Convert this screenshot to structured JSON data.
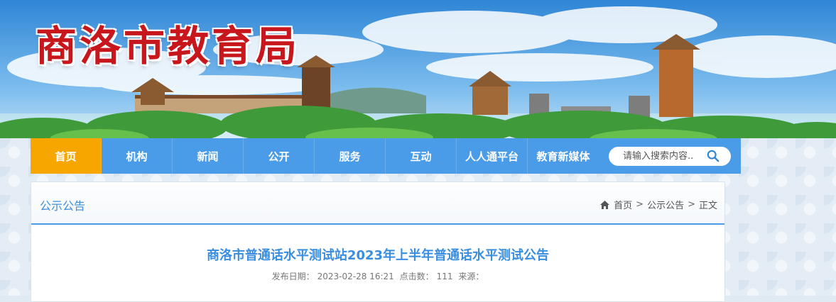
{
  "site": {
    "title": "商洛市教育局"
  },
  "nav": {
    "items": [
      {
        "label": "首页",
        "active": true
      },
      {
        "label": "机构"
      },
      {
        "label": "新闻"
      },
      {
        "label": "公开"
      },
      {
        "label": "服务"
      },
      {
        "label": "互动"
      },
      {
        "label": "人人通平台"
      },
      {
        "label": "教育新媒体"
      }
    ]
  },
  "search": {
    "placeholder": "请输入搜索内容.."
  },
  "section": {
    "title": "公示公告"
  },
  "breadcrumb": {
    "home": "首页",
    "sep": ">",
    "category": "公示公告",
    "current": "正文"
  },
  "article": {
    "title": "商洛市普通话水平测试站2023年上半年普通话水平测试公告",
    "date_label": "发布日期：",
    "date": "2023-02-28 16:21",
    "clicks_label": "点击数：",
    "clicks": "111",
    "source_label": "来源："
  },
  "colors": {
    "nav_bg": "#4a9ce8",
    "nav_active": "#f7a600",
    "title_red": "#c8161d",
    "accent_blue": "#3a8ee0"
  }
}
